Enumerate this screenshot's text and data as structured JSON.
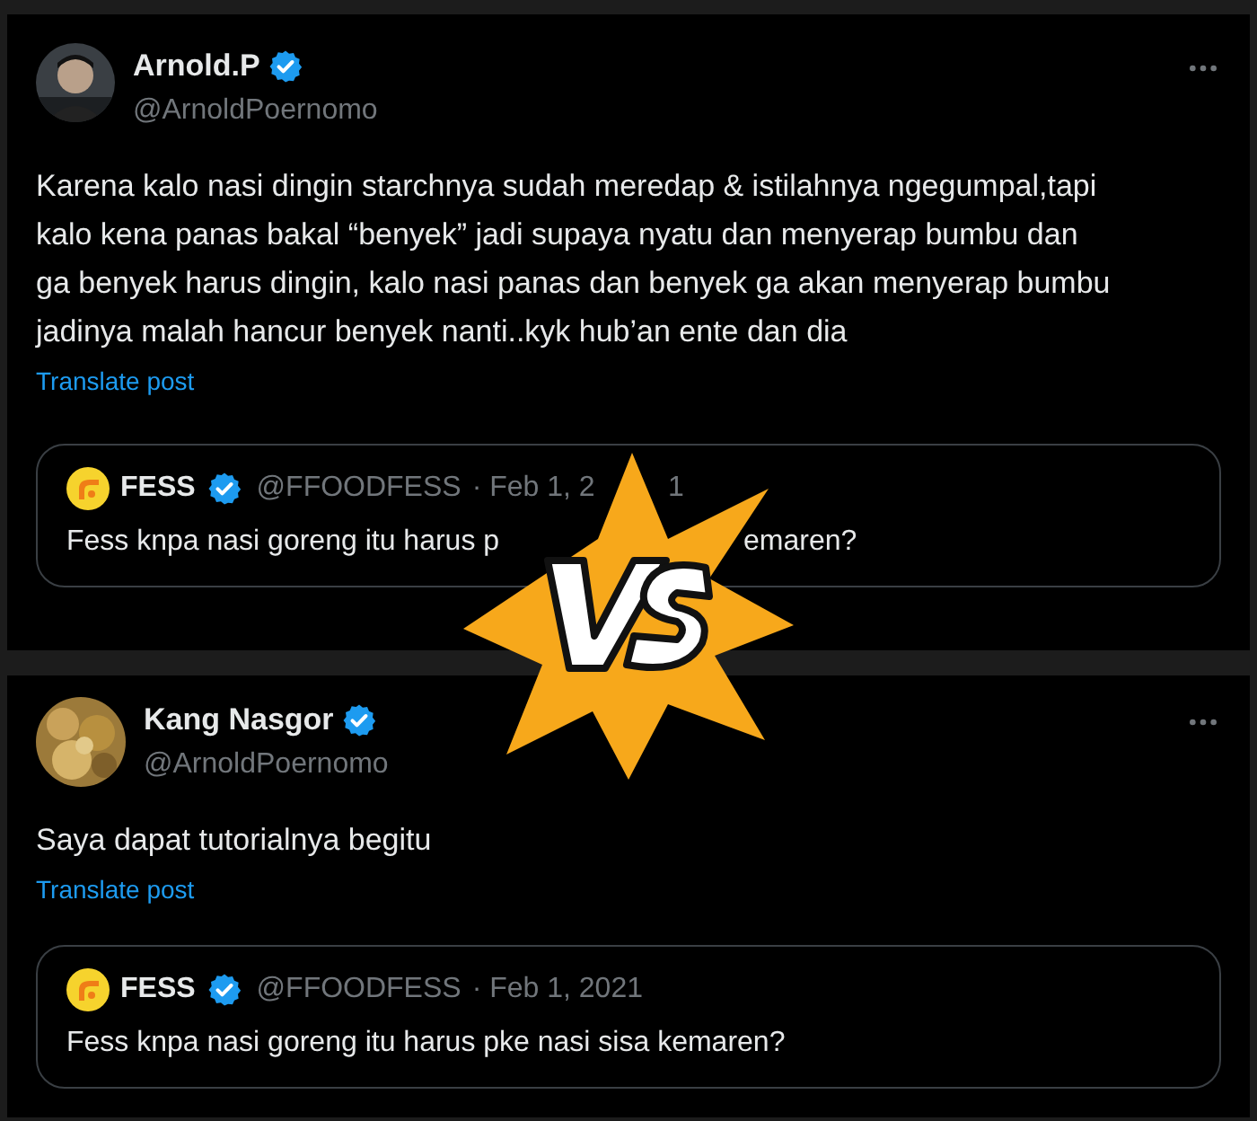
{
  "posts": [
    {
      "kind": "person",
      "name": "Arnold.P",
      "verified": true,
      "handle": "@ArnoldPoernomo",
      "text": "Karena kalo nasi dingin starchnya sudah meredap & istilahnya ngegumpal,tapi kalo kena panas bakal “benyek” jadi supaya nyatu dan menyerap bumbu dan ga benyek harus dingin, kalo nasi panas dan benyek ga akan menyerap bumbu jadinya malah hancur benyek nanti..kyk hub’an ente dan dia",
      "translate": "Translate post",
      "quote": {
        "name": "FESS",
        "verified": true,
        "handle": "@FFOODFESS",
        "date_parts": [
          "· Feb 1, 2",
          "1"
        ],
        "text_parts": [
          "Fess knpa nasi goreng itu harus p",
          "emaren?"
        ]
      }
    },
    {
      "kind": "food",
      "name": "Kang Nasgor",
      "verified": true,
      "handle": "@ArnoldPoernomo",
      "text": "Saya dapat tutorialnya begitu",
      "translate": "Translate post",
      "quote": {
        "name": "FESS",
        "verified": true,
        "handle": "@FFOODFESS",
        "date_parts": [
          "· Feb 1, 2021"
        ],
        "text_parts": [
          "Fess knpa nasi goreng itu harus pke nasi sisa kemaren?"
        ]
      }
    }
  ],
  "overlay": {
    "kind": "versus"
  }
}
